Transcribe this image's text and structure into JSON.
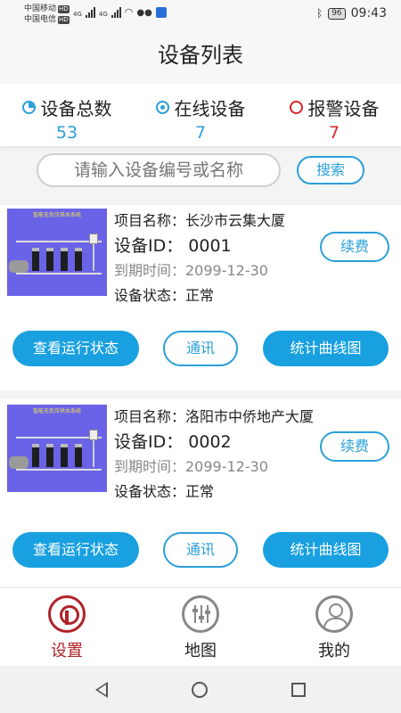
{
  "status_bar": {
    "carrier1": "中国移动",
    "carrier2": "中国电信",
    "hd_label": "HD",
    "network1": "4G",
    "network2": "4G",
    "battery": "96",
    "time": "09:43",
    "icons": [
      "signal-icon",
      "wifi-icon",
      "wechat-icon",
      "app-icon",
      "bluetooth-icon",
      "battery-icon"
    ]
  },
  "header": {
    "title": "设备列表"
  },
  "stats": [
    {
      "label": "设备总数",
      "value": "53",
      "icon": "pie-icon",
      "color": "#2a9fd8"
    },
    {
      "label": "在线设备",
      "value": "7",
      "icon": "radio-icon",
      "color": "#2a9fd8"
    },
    {
      "label": "报警设备",
      "value": "7",
      "icon": "ring-icon",
      "color": "#d9262c"
    }
  ],
  "search": {
    "placeholder": "请输入设备编号或名称",
    "button": "搜索"
  },
  "devices": [
    {
      "thumb_caption": "智能无负压供水系统",
      "project": "项目名称：长沙市云集大厦",
      "device_id": "设备ID：  0001",
      "expire": "到期时间：2099-12-30",
      "state": "设备状态：正常",
      "renew": "续费",
      "btn_status": "查看运行状态",
      "btn_comm": "通讯",
      "btn_chart": "统计曲线图"
    },
    {
      "thumb_caption": "智能无负压供水系统",
      "project": "项目名称：洛阳市中侨地产大厦",
      "device_id": "设备ID：  0002",
      "expire": "到期时间：2099-12-30",
      "state": "设备状态：正常",
      "renew": "续费",
      "btn_status": "查看运行状态",
      "btn_comm": "通讯",
      "btn_chart": "统计曲线图"
    }
  ],
  "tabbar": [
    {
      "label": "设置",
      "icon": "settings-icon",
      "active": true,
      "color": "#b02228"
    },
    {
      "label": "地图",
      "icon": "map-icon",
      "active": false,
      "color": "#222222"
    },
    {
      "label": "我的",
      "icon": "profile-icon",
      "active": false,
      "color": "#222222"
    }
  ],
  "colors": {
    "accent": "#19a0e0",
    "alarm": "#d9262c",
    "active_tab": "#b02228"
  }
}
